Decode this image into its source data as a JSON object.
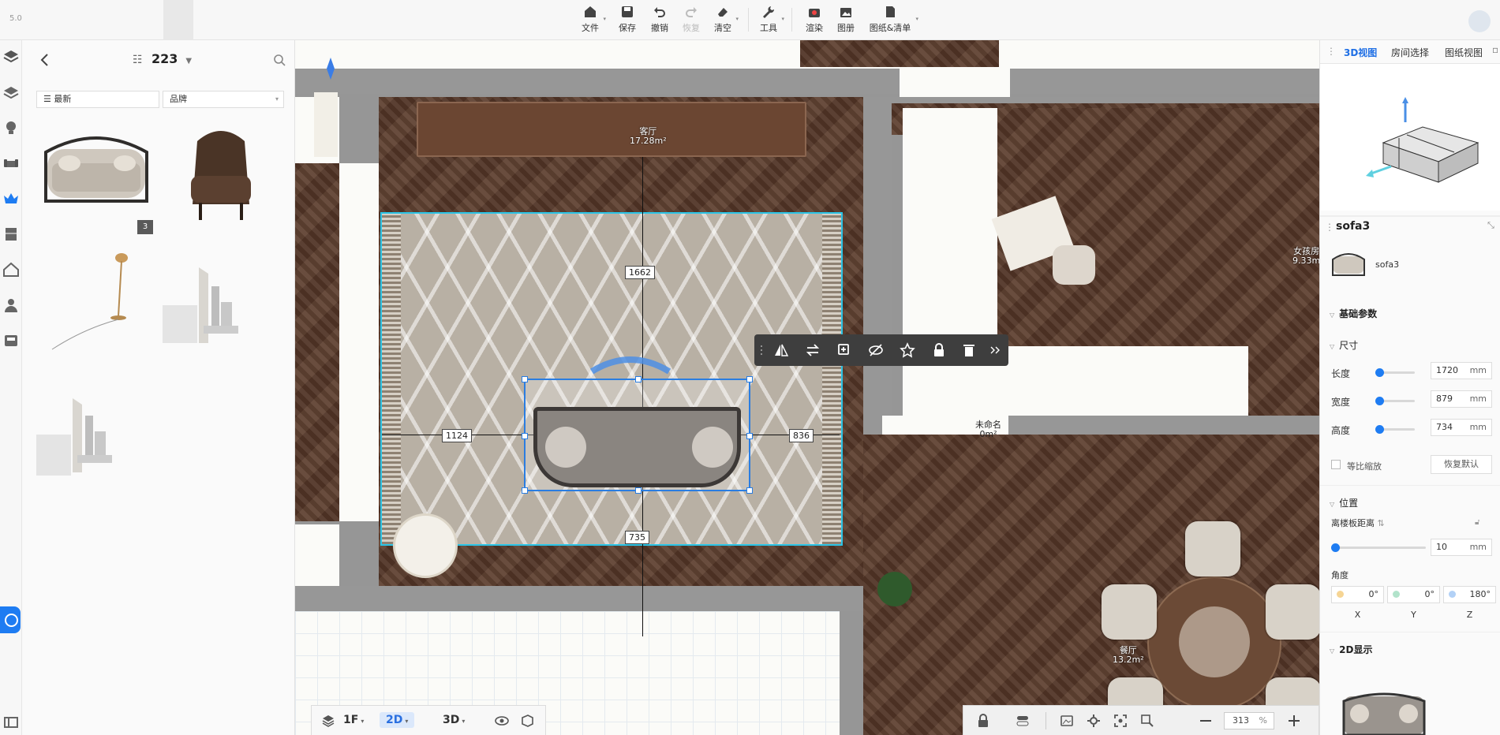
{
  "app": {
    "version": "5.0"
  },
  "toolbar": {
    "file": "文件",
    "save": "保存",
    "undo": "撤销",
    "redo": "恢复",
    "clear": "清空",
    "tools": "工具",
    "render": "渲染",
    "gallery": "图册",
    "drawings": "图纸&清单"
  },
  "catalog": {
    "title": "223",
    "filter_sort": "最新",
    "filter_brand": "品牌",
    "items": [
      {
        "name": "sofa-thumb",
        "badge": "3"
      },
      {
        "name": "armchair-thumb",
        "badge": ""
      },
      {
        "name": "floor-lamp-thumb",
        "badge": ""
      },
      {
        "name": "decor-set-thumb",
        "badge": ""
      },
      {
        "name": "decor-set-2-thumb",
        "badge": ""
      }
    ]
  },
  "canvas": {
    "rooms": [
      {
        "name": "客厅",
        "area": "17.28m²"
      },
      {
        "name": "未命名",
        "area": "0m²"
      },
      {
        "name": "餐厅",
        "area": "13.2m²"
      },
      {
        "name": "女孩房",
        "area": "9.33m"
      }
    ],
    "dimensions": {
      "top": "1662",
      "left": "1124",
      "right": "836",
      "bottom": "735"
    }
  },
  "view_controls": {
    "floor": "1F",
    "mode_2d": "2D",
    "mode_3d": "3D"
  },
  "zoom": {
    "value": "313",
    "unit": "%"
  },
  "right_panel": {
    "tabs": [
      "3D视图",
      "房间选择",
      "图纸视图"
    ],
    "object_title": "sofa3",
    "object_name": "sofa3",
    "sections": {
      "basic": "基础参数",
      "size": "尺寸",
      "position": "位置",
      "display2d": "2D显示"
    },
    "size": [
      {
        "label": "长度",
        "value": "1720",
        "unit": "mm"
      },
      {
        "label": "宽度",
        "value": "879",
        "unit": "mm"
      },
      {
        "label": "高度",
        "value": "734",
        "unit": "mm"
      }
    ],
    "proportional": "等比缩放",
    "reset": "恢复默认",
    "height_from_floor": "离楼板距离",
    "height_value": "10",
    "height_unit": "mm",
    "angle_label": "角度",
    "angles": [
      {
        "axis": "X",
        "value": "0°"
      },
      {
        "axis": "Y",
        "value": "0°"
      },
      {
        "axis": "Z",
        "value": "180°"
      }
    ]
  }
}
